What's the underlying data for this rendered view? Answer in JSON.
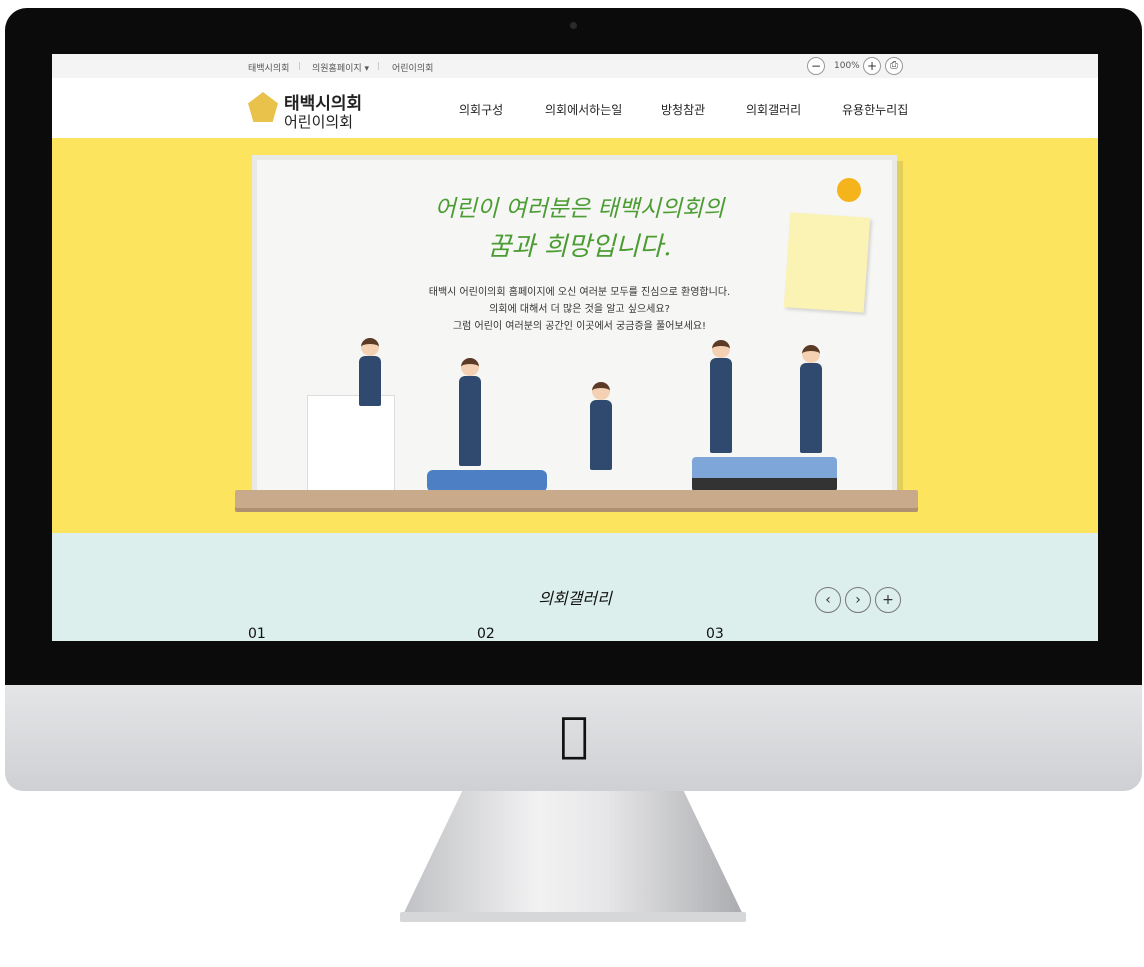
{
  "topbar": {
    "links": [
      "태백시의회",
      "의원홈페이지 ▾",
      "어린이의회"
    ],
    "zoom_out": "−",
    "zoom_level": "100%",
    "zoom_in": "+",
    "print": "⎙"
  },
  "header": {
    "logo_line1": "태백시의회",
    "logo_line2": "어린이의회",
    "nav": [
      "의회구성",
      "의회에서하는일",
      "방청참관",
      "의회갤러리",
      "유용한누리집"
    ]
  },
  "hero": {
    "headline1": "어린이 여러분은 태백시의회의",
    "headline2": "꿈과 희망입니다.",
    "lines": [
      "태백시 어린이의회 홈페이지에 오신 여러분 모두를 진심으로 환영합니다.",
      "의회에 대해서 더 많은 것을 알고 싶으세요?",
      "그럼 어린이 여러분의 공간인 이곳에서 궁금증을 풀어보세요!"
    ]
  },
  "gallery": {
    "title": "의회갤러리",
    "prev": "‹",
    "next": "›",
    "more": "+",
    "items": [
      "01",
      "02",
      "03"
    ]
  },
  "device": {
    "logo": ""
  }
}
